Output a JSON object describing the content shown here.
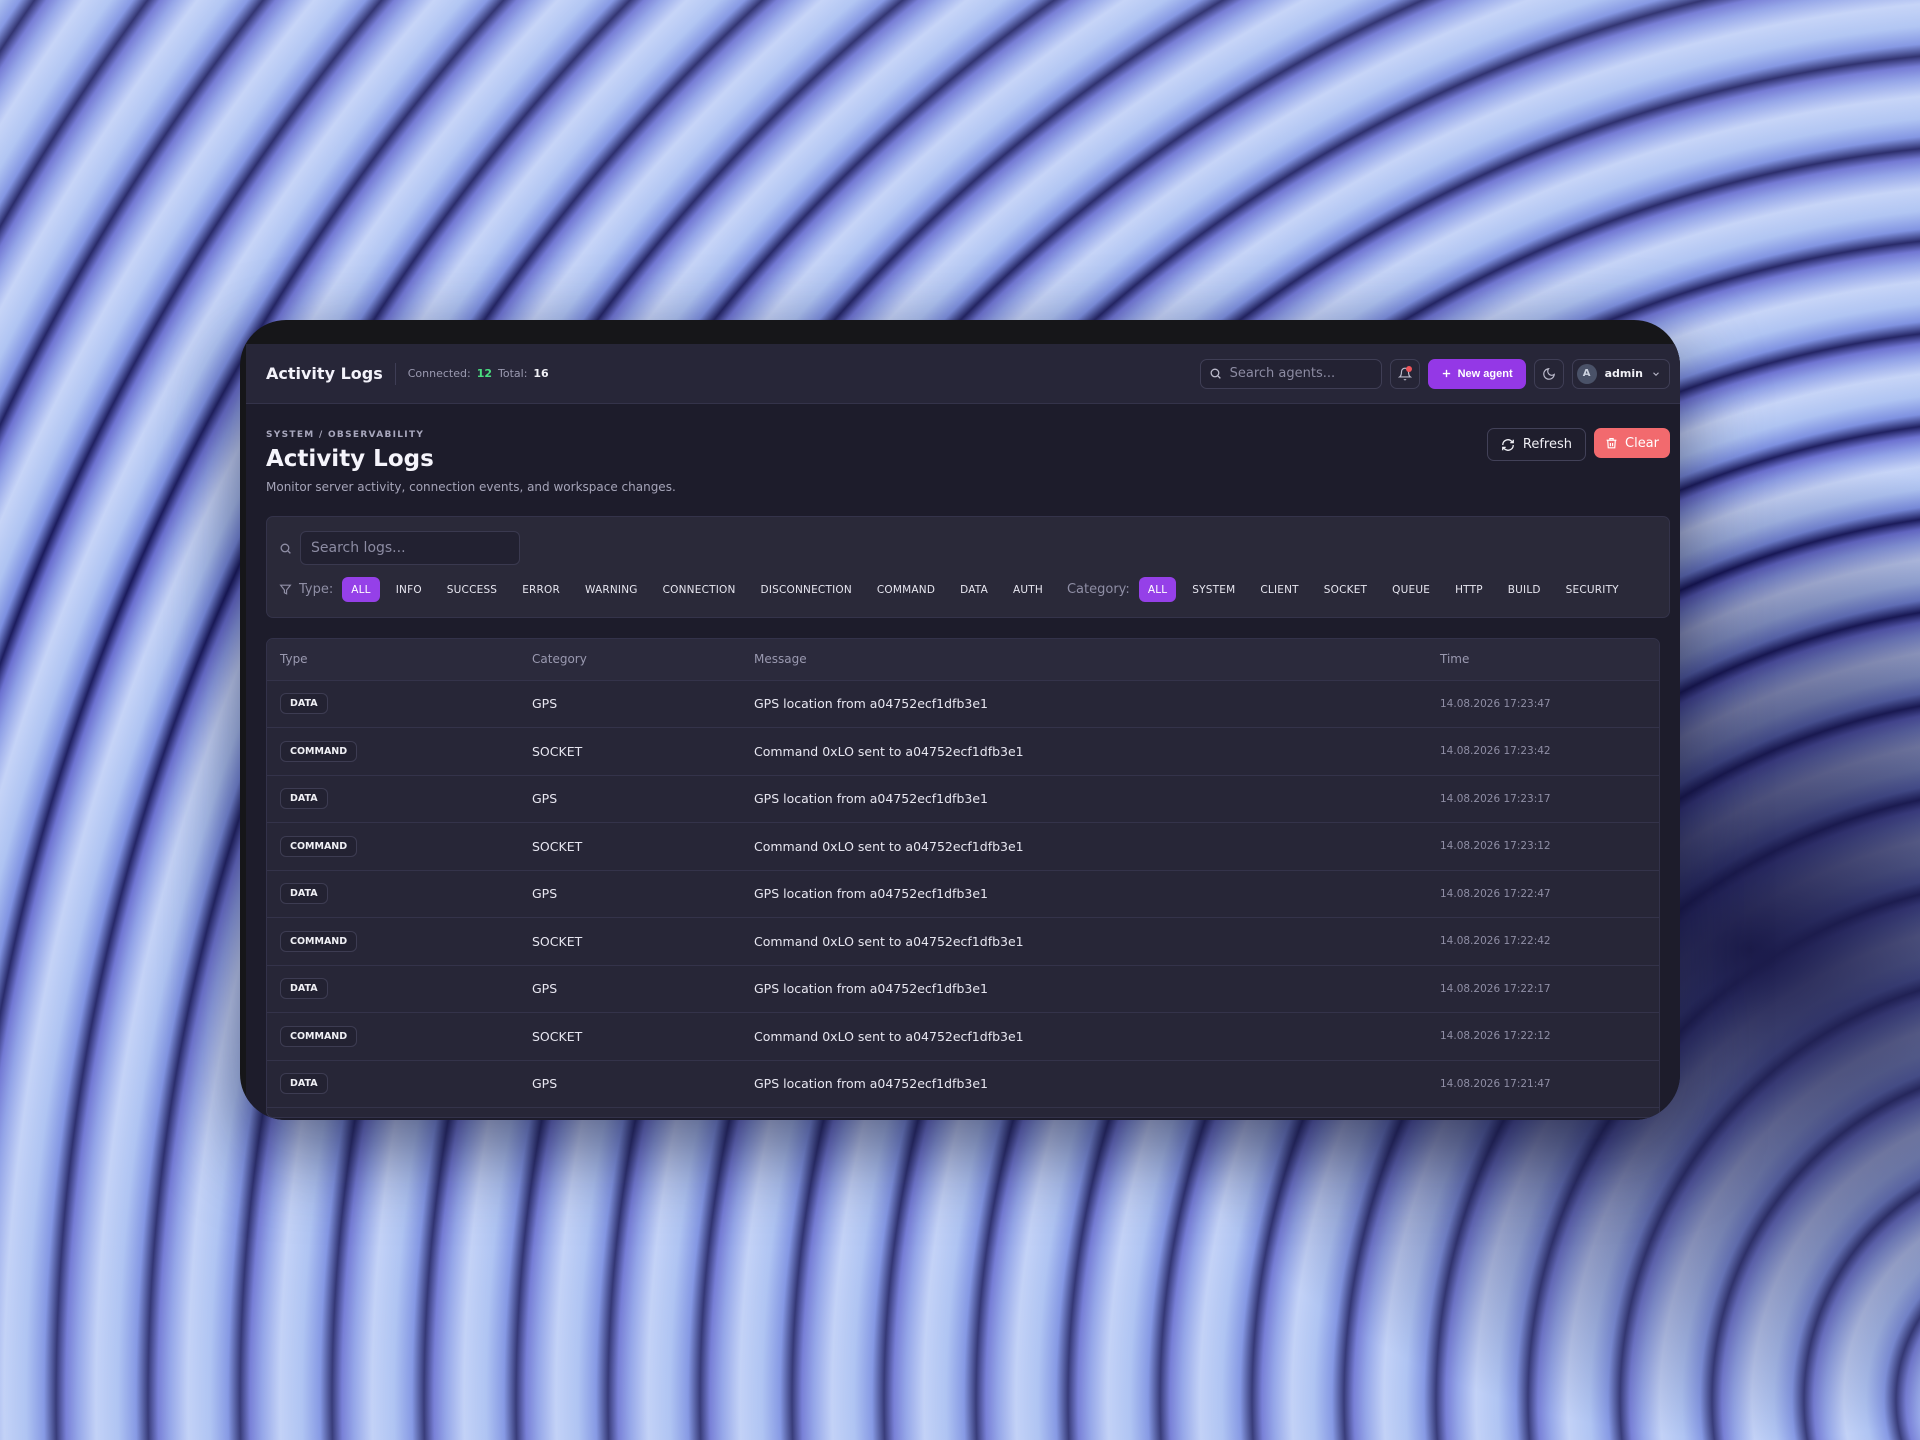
{
  "header": {
    "title": "Activity Logs",
    "connected_label": "Connected:",
    "connected_count": "12",
    "total_label": "Total:",
    "total_count": "16",
    "search_placeholder": "Search agents...",
    "new_agent_label": "New agent",
    "user_initial": "A",
    "username": "admin"
  },
  "page": {
    "breadcrumb": "SYSTEM / OBSERVABILITY",
    "title": "Activity Logs",
    "subtitle": "Monitor server activity, connection events, and workspace changes.",
    "refresh_label": "Refresh",
    "clear_label": "Clear"
  },
  "filters": {
    "search_placeholder": "Search logs...",
    "type_label": "Type:",
    "types": [
      "ALL",
      "INFO",
      "SUCCESS",
      "ERROR",
      "WARNING",
      "CONNECTION",
      "DISCONNECTION",
      "COMMAND",
      "DATA",
      "AUTH"
    ],
    "active_type": "ALL",
    "category_label": "Category:",
    "categories": [
      "ALL",
      "SYSTEM",
      "CLIENT",
      "SOCKET",
      "QUEUE",
      "HTTP",
      "BUILD",
      "SECURITY"
    ],
    "active_category": "ALL"
  },
  "table": {
    "columns": [
      "Type",
      "Category",
      "Message",
      "Time"
    ],
    "rows": [
      {
        "type": "DATA",
        "category": "GPS",
        "message": "GPS location from a04752ecf1dfb3e1",
        "time": "14.08.2026 17:23:47"
      },
      {
        "type": "COMMAND",
        "category": "SOCKET",
        "message": "Command 0xLO sent to a04752ecf1dfb3e1",
        "time": "14.08.2026 17:23:42"
      },
      {
        "type": "DATA",
        "category": "GPS",
        "message": "GPS location from a04752ecf1dfb3e1",
        "time": "14.08.2026 17:23:17"
      },
      {
        "type": "COMMAND",
        "category": "SOCKET",
        "message": "Command 0xLO sent to a04752ecf1dfb3e1",
        "time": "14.08.2026 17:23:12"
      },
      {
        "type": "DATA",
        "category": "GPS",
        "message": "GPS location from a04752ecf1dfb3e1",
        "time": "14.08.2026 17:22:47"
      },
      {
        "type": "COMMAND",
        "category": "SOCKET",
        "message": "Command 0xLO sent to a04752ecf1dfb3e1",
        "time": "14.08.2026 17:22:42"
      },
      {
        "type": "DATA",
        "category": "GPS",
        "message": "GPS location from a04752ecf1dfb3e1",
        "time": "14.08.2026 17:22:17"
      },
      {
        "type": "COMMAND",
        "category": "SOCKET",
        "message": "Command 0xLO sent to a04752ecf1dfb3e1",
        "time": "14.08.2026 17:22:12"
      },
      {
        "type": "DATA",
        "category": "GPS",
        "message": "GPS location from a04752ecf1dfb3e1",
        "time": "14.08.2026 17:21:47"
      }
    ]
  },
  "colors": {
    "accent": "#9438e6",
    "danger": "#f26a6e",
    "connected": "#4ade80"
  },
  "icons": {
    "search": "search-icon",
    "bell": "bell-icon",
    "plus": "plus-icon",
    "theme": "moon-icon",
    "chevron": "chevron-down-icon",
    "refresh": "refresh-icon",
    "trash": "trash-icon",
    "filter": "filter-icon"
  }
}
